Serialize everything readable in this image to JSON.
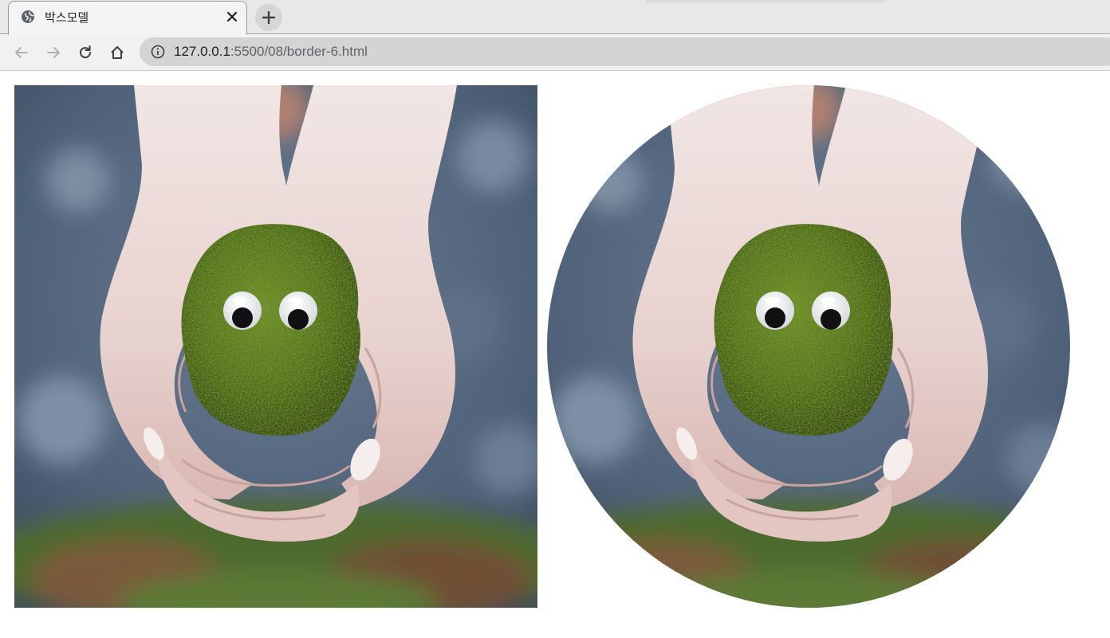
{
  "browser": {
    "tab": {
      "title": "박스모델",
      "favicon": "globe-icon",
      "close_icon": "close-icon"
    },
    "new_tab_icon": "plus-icon",
    "nav": {
      "back_icon": "arrow-left-icon",
      "forward_icon": "arrow-right-icon",
      "reload_icon": "reload-icon",
      "home_icon": "home-icon"
    },
    "address": {
      "info_icon": "info-icon",
      "host": "127.0.0.1",
      "path": ":5500/08/border-6.html"
    }
  },
  "page": {
    "images": [
      {
        "name": "moss-creature-photo",
        "shape": "square"
      },
      {
        "name": "moss-creature-photo",
        "shape": "circle"
      }
    ]
  },
  "colors": {
    "tab_active": "#f4f4f4",
    "tabstrip": "#e8e8e8",
    "toolbar": "#f1f1f1",
    "omnibox": "#d4d4d4",
    "moss": "#4f6a1a",
    "background_blur": "#5d6f86"
  }
}
